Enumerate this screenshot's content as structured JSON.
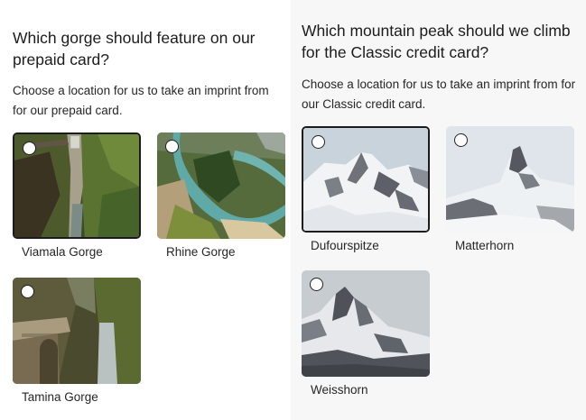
{
  "prepaid": {
    "question": "Which gorge should feature on our prepaid card?",
    "description": "Choose a location for us to take an imprint from for our prepaid card.",
    "options": [
      {
        "label": "Viamala Gorge",
        "selected": true
      },
      {
        "label": "Rhine Gorge",
        "selected": false
      },
      {
        "label": "Tamina Gorge",
        "selected": false
      }
    ]
  },
  "classic": {
    "question": "Which mountain peak should we climb for the Classic credit card?",
    "description": "Choose a location for us to take an imprint from for our Classic credit card.",
    "options": [
      {
        "label": "Dufourspitze",
        "selected": true
      },
      {
        "label": "Matterhorn",
        "selected": false
      },
      {
        "label": "Weisshorn",
        "selected": false
      }
    ]
  }
}
